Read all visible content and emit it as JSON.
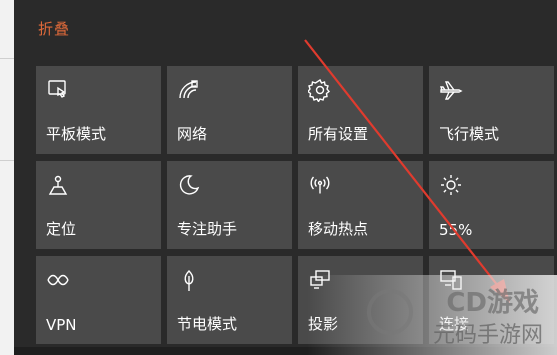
{
  "header": {
    "collapse_label": "折叠"
  },
  "tiles": [
    {
      "label": "平板模式",
      "icon": "tablet-mode-icon"
    },
    {
      "label": "网络",
      "icon": "network-icon"
    },
    {
      "label": "所有设置",
      "icon": "settings-gear-icon"
    },
    {
      "label": "飞行模式",
      "icon": "airplane-icon"
    },
    {
      "label": "定位",
      "icon": "location-icon"
    },
    {
      "label": "专注助手",
      "icon": "focus-assist-moon-icon"
    },
    {
      "label": "移动热点",
      "icon": "mobile-hotspot-icon"
    },
    {
      "label": "55%",
      "icon": "brightness-icon"
    },
    {
      "label": "VPN",
      "icon": "vpn-icon"
    },
    {
      "label": "节电模式",
      "icon": "battery-saver-icon"
    },
    {
      "label": "投影",
      "icon": "project-icon"
    },
    {
      "label": "连接",
      "icon": "connect-icon"
    }
  ],
  "watermark": {
    "top": "CD游戏",
    "bottom": "元码手游网"
  },
  "colors": {
    "accent": "#e06a3a",
    "tile": "#4a4a4a",
    "arrow": "#e03b2e"
  }
}
